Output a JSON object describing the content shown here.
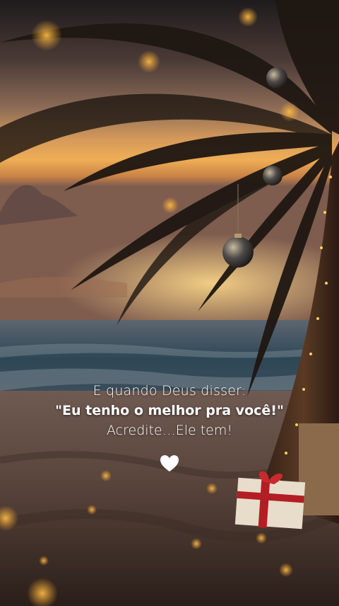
{
  "quote": {
    "line1": "E quando Deus disser:",
    "line2": "\"Eu tenho o melhor pra você!\"",
    "line3": "Acredite…Ele tem!"
  },
  "icons": {
    "heart": "white-heart-icon"
  },
  "colors": {
    "sky_top": "#1c1a1c",
    "sunset_orange": "#e79a45",
    "sunset_glow": "#f6c46a",
    "sea": "#2f4654",
    "sand": "#5c463d",
    "text": "#ffffff"
  }
}
